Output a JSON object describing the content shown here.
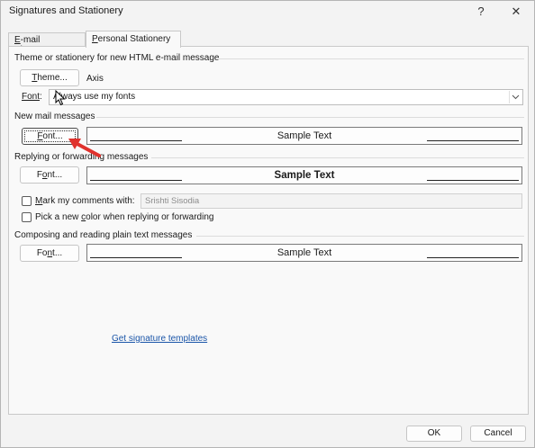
{
  "window": {
    "title": "Signatures and Stationery",
    "help_label": "?",
    "close_label": "✕"
  },
  "tabs": [
    {
      "label_u": "E",
      "label_rest": "-mail Signature"
    },
    {
      "label_u": "P",
      "label_rest": "ersonal Stationery"
    }
  ],
  "theme_section": {
    "heading": "Theme or stationery for new HTML e-mail message",
    "theme_button_u": "T",
    "theme_button_rest": "heme...",
    "theme_name": "Axis",
    "font_label_pre": "Font",
    "font_label_post": ":",
    "font_select_value": "Always use my fonts"
  },
  "new_mail": {
    "heading": "New mail messages",
    "font_button_u": "F",
    "font_button_rest": "ont...",
    "sample_text": "Sample Text"
  },
  "reply": {
    "heading": "Replying or forwarding messages",
    "font_button_pre": "F",
    "font_button_u": "o",
    "font_button_rest": "nt...",
    "sample_text": "Sample Text",
    "mark_comments_u": "M",
    "mark_comments_rest": "ark my comments with:",
    "mark_comments_value": "Srishti Sisodia",
    "pick_color_pre": "Pick a new ",
    "pick_color_u": "c",
    "pick_color_rest": "olor when replying or forwarding"
  },
  "plain_text": {
    "heading": "Composing and reading plain text messages",
    "font_button_pre": "Fo",
    "font_button_u": "n",
    "font_button_rest": "t...",
    "sample_text": "Sample Text"
  },
  "link": {
    "text": "Get signature templates"
  },
  "footer": {
    "ok_label": "OK",
    "cancel_label": "Cancel"
  },
  "colors": {
    "link": "#1a55a8",
    "annotation_arrow": "#e0322d"
  }
}
